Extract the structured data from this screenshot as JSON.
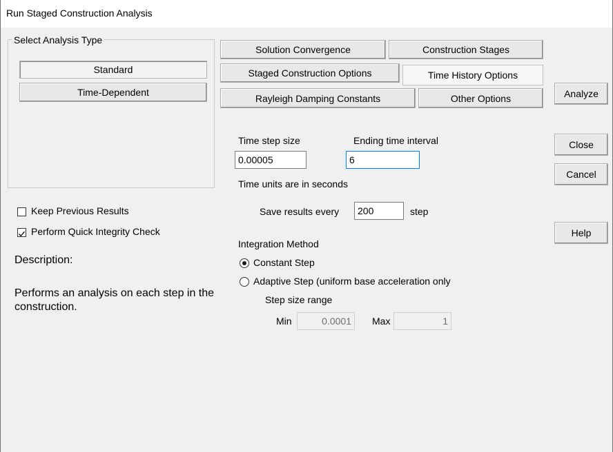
{
  "window": {
    "title": "Run Staged Construction Analysis"
  },
  "analysis_type": {
    "group_label": "Select Analysis Type",
    "standard_label": "Standard",
    "time_dependent_label": "Time-Dependent",
    "selected": "Standard"
  },
  "tabs": {
    "solution_convergence": "Solution Convergence",
    "construction_stages": "Construction Stages",
    "staged_construction_options": "Staged Construction Options",
    "time_history_options": "Time History Options",
    "rayleigh_damping": "Rayleigh Damping Constants",
    "other_options": "Other Options",
    "active": "Time History Options"
  },
  "time_history": {
    "time_step_label": "Time step size",
    "time_step_value": "0.00005",
    "ending_interval_label": "Ending time interval",
    "ending_interval_value": "6",
    "units_note": "Time units are in seconds",
    "save_every_label": "Save results every",
    "save_every_value": "200",
    "step_label": "step",
    "integration_label": "Integration Method",
    "constant_step_label": "Constant Step",
    "adaptive_step_label": "Adaptive Step (uniform base acceleration only",
    "selected_method": "Constant Step",
    "step_range_label": "Step size range",
    "min_label": "Min",
    "min_value": "0.0001",
    "max_label": "Max",
    "max_value": "1"
  },
  "options": {
    "keep_previous_label": "Keep Previous Results",
    "keep_previous_checked": false,
    "quick_integrity_label": "Perform Quick Integrity Check",
    "quick_integrity_checked": true
  },
  "description": {
    "label": "Description:",
    "text": "Performs an analysis on each step in the construction."
  },
  "actions": {
    "analyze": "Analyze",
    "close": "Close",
    "cancel": "Cancel",
    "help": "Help"
  }
}
